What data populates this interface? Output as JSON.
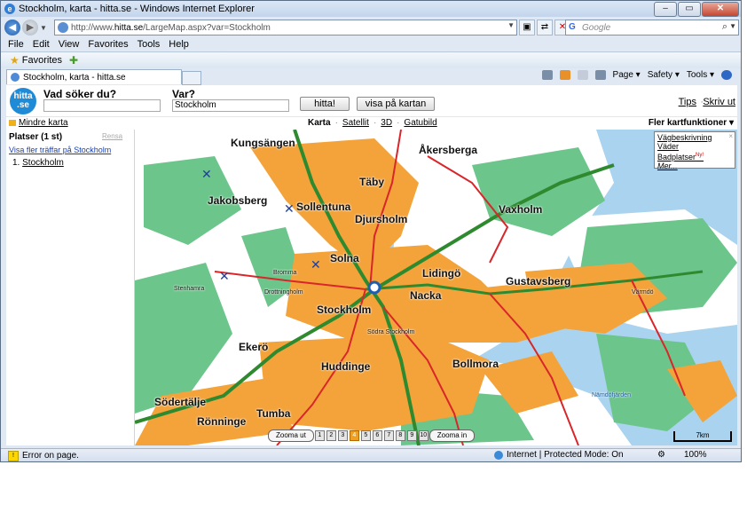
{
  "window": {
    "title": "Stockholm, karta - hitta.se - Windows Internet Explorer",
    "controls": {
      "minimize": "–",
      "maximize": "▭",
      "close": "✕"
    }
  },
  "address_bar": {
    "url_prefix": "http://www.",
    "url_host": "hitta.se",
    "url_path": "/LargeMap.aspx?var=Stockholm"
  },
  "search": {
    "placeholder": "Google"
  },
  "menu": [
    "File",
    "Edit",
    "View",
    "Favorites",
    "Tools",
    "Help"
  ],
  "favorites_bar": {
    "label": "Favorites"
  },
  "tab": {
    "label": "Stockholm, karta - hitta.se"
  },
  "command_bar": {
    "page": "Page ▾",
    "safety": "Safety ▾",
    "tools": "Tools ▾"
  },
  "site": {
    "logo": "hitta .se",
    "what_label": "Vad söker du?",
    "what_value": "",
    "where_label": "Var?",
    "where_value": "Stockholm",
    "find_button": "hitta!",
    "show_map_button": "visa på kartan",
    "tips": "Tips",
    "dot": "·",
    "print": "Skriv ut",
    "smaller_map": "Mindre karta",
    "views": {
      "karta": "Karta",
      "satellit": "Satellit",
      "d3": "3D",
      "gatubild": "Gatubild",
      "sep": "·"
    },
    "more_functions": "Fler kartfunktioner ▾"
  },
  "sidebar": {
    "title": "Platser (1 st)",
    "clear": "Rensa",
    "show_more": "Visa fler träffar på Stockholm",
    "item_number": "1.",
    "item_label": "Stockholm"
  },
  "map": {
    "popup": {
      "route": "Vägbeskrivning",
      "weather": "Väder",
      "beaches": "Badplatser",
      "new": "Ny!",
      "more": "Mer...",
      "close": "×"
    },
    "labels": {
      "kungsangen": "Kungsängen",
      "akersberga": "Åkersberga",
      "taby": "Täby",
      "jakobsberg": "Jakobsberg",
      "sollentuna": "Sollentuna",
      "djursholm": "Djursholm",
      "vaxholm": "Vaxholm",
      "solna": "Solna",
      "lidingo": "Lidingö",
      "gustavsberg": "Gustavsberg",
      "stockholm": "Stockholm",
      "nacka": "Nacka",
      "ekero": "Ekerö",
      "huddinge": "Huddinge",
      "bollmora": "Bollmora",
      "sodertalje": "Södertälje",
      "tumba": "Tumba",
      "ronninge": "Rönninge",
      "stenhamra": "Stenhamra",
      "drottningholm": "Drottningholm",
      "bromma": "Bromma",
      "sodra": "Södra Stockholm",
      "varmdo": "Värmdö",
      "nordstromsfjarden": "Nämdöfjärden"
    },
    "zoom_out": "Zooma ut",
    "zoom_in": "Zooma in",
    "zoom_levels": [
      "1",
      "2",
      "3",
      "4",
      "5",
      "6",
      "7",
      "8",
      "9",
      "10"
    ],
    "zoom_level_current": 4,
    "scale": "7km",
    "colors": {
      "water": "#a9d3ee",
      "land": "#ffffff",
      "urban": "#f3a33a",
      "forest": "#6cc58a",
      "road": "#d8262b",
      "motorway": "#2f8a2f"
    }
  },
  "status_bar": {
    "error": "Error on page.",
    "zone": "Internet | Protected Mode: On",
    "zoom": "100%"
  }
}
